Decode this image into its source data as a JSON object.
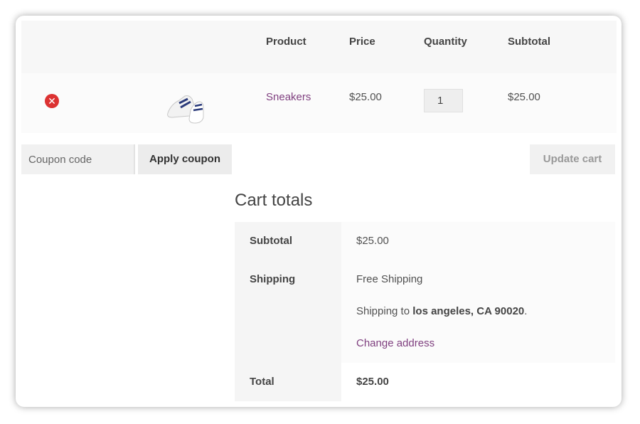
{
  "table": {
    "headers": {
      "product": "Product",
      "price": "Price",
      "quantity": "Quantity",
      "subtotal": "Subtotal"
    },
    "rows": [
      {
        "product": "Sneakers",
        "price": "$25.00",
        "quantity": "1",
        "subtotal": "$25.00"
      }
    ]
  },
  "actions": {
    "coupon_placeholder": "Coupon code",
    "apply_coupon": "Apply coupon",
    "update_cart": "Update cart"
  },
  "totals": {
    "title": "Cart totals",
    "subtotal_label": "Subtotal",
    "subtotal_value": "$25.00",
    "shipping_label": "Shipping",
    "shipping_method": "Free Shipping",
    "shipping_to_prefix": "Shipping to ",
    "shipping_to_address": "los angeles, CA 90020",
    "shipping_to_suffix": ".",
    "change_address": "Change address",
    "total_label": "Total",
    "total_value": "$25.00"
  },
  "colors": {
    "link": "#7f3f7f",
    "remove": "#dc3232"
  }
}
